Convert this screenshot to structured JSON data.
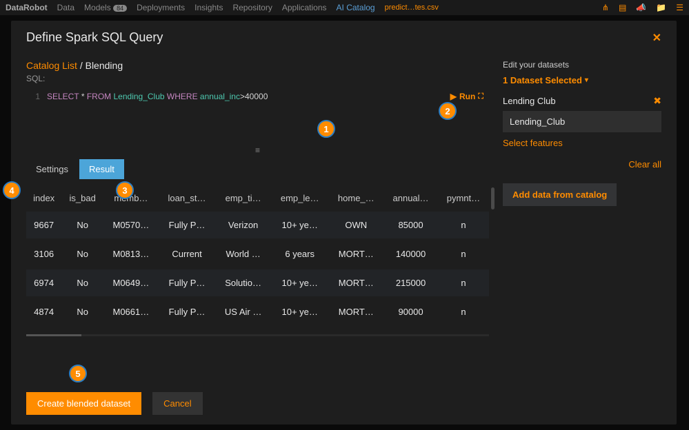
{
  "topbar": {
    "logo": "DataRobot",
    "items": [
      "Data",
      "Models",
      "Deployments",
      "Insights",
      "Repository",
      "Applications",
      "AI Catalog"
    ],
    "models_badge": "84",
    "file": "predict…tes.csv"
  },
  "modal": {
    "title": "Define Spark SQL Query"
  },
  "breadcrumb": {
    "link": "Catalog List",
    "current": "Blending"
  },
  "sql": {
    "label": "SQL:",
    "line": "1",
    "kw_select": "SELECT",
    "star": "*",
    "kw_from": "FROM",
    "table": "Lending_Club",
    "kw_where": "WHERE",
    "col": "annual_inc",
    "op": ">",
    "val": "40000"
  },
  "run": {
    "label": "Run"
  },
  "tabs": {
    "settings": "Settings",
    "result": "Result"
  },
  "table": {
    "headers": [
      "index",
      "is_bad",
      "memb…",
      "loan_st…",
      "emp_ti…",
      "emp_le…",
      "home_…",
      "annual…",
      "pymnt…"
    ],
    "rows": [
      [
        "9667",
        "No",
        "M0570…",
        "Fully P…",
        "Verizon",
        "10+ ye…",
        "OWN",
        "85000",
        "n"
      ],
      [
        "3106",
        "No",
        "M0813…",
        "Current",
        "World …",
        "6 years",
        "MORT…",
        "140000",
        "n"
      ],
      [
        "6974",
        "No",
        "M0649…",
        "Fully P…",
        "Solutio…",
        "10+ ye…",
        "MORT…",
        "215000",
        "n"
      ],
      [
        "4874",
        "No",
        "M0661…",
        "Fully P…",
        "US Air …",
        "10+ ye…",
        "MORT…",
        "90000",
        "n"
      ]
    ]
  },
  "buttons": {
    "create": "Create blended dataset",
    "cancel": "Cancel"
  },
  "side": {
    "edit_label": "Edit your datasets",
    "selected": "1 Dataset Selected",
    "dataset": "Lending Club",
    "alias": "Lending_Club",
    "select_features": "Select features",
    "clear_all": "Clear all",
    "add_data": "Add data from catalog"
  },
  "markers": {
    "m1": "1",
    "m2": "2",
    "m3": "3",
    "m4": "4",
    "m5": "5"
  }
}
